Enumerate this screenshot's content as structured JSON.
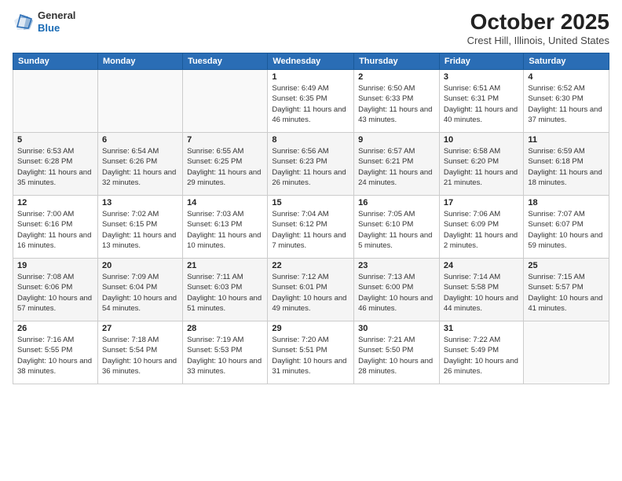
{
  "header": {
    "logo": {
      "line1": "General",
      "line2": "Blue"
    },
    "title": "October 2025",
    "location": "Crest Hill, Illinois, United States"
  },
  "weekdays": [
    "Sunday",
    "Monday",
    "Tuesday",
    "Wednesday",
    "Thursday",
    "Friday",
    "Saturday"
  ],
  "weeks": [
    [
      {
        "day": "",
        "sunrise": "",
        "sunset": "",
        "daylight": ""
      },
      {
        "day": "",
        "sunrise": "",
        "sunset": "",
        "daylight": ""
      },
      {
        "day": "",
        "sunrise": "",
        "sunset": "",
        "daylight": ""
      },
      {
        "day": "1",
        "sunrise": "Sunrise: 6:49 AM",
        "sunset": "Sunset: 6:35 PM",
        "daylight": "Daylight: 11 hours and 46 minutes."
      },
      {
        "day": "2",
        "sunrise": "Sunrise: 6:50 AM",
        "sunset": "Sunset: 6:33 PM",
        "daylight": "Daylight: 11 hours and 43 minutes."
      },
      {
        "day": "3",
        "sunrise": "Sunrise: 6:51 AM",
        "sunset": "Sunset: 6:31 PM",
        "daylight": "Daylight: 11 hours and 40 minutes."
      },
      {
        "day": "4",
        "sunrise": "Sunrise: 6:52 AM",
        "sunset": "Sunset: 6:30 PM",
        "daylight": "Daylight: 11 hours and 37 minutes."
      }
    ],
    [
      {
        "day": "5",
        "sunrise": "Sunrise: 6:53 AM",
        "sunset": "Sunset: 6:28 PM",
        "daylight": "Daylight: 11 hours and 35 minutes."
      },
      {
        "day": "6",
        "sunrise": "Sunrise: 6:54 AM",
        "sunset": "Sunset: 6:26 PM",
        "daylight": "Daylight: 11 hours and 32 minutes."
      },
      {
        "day": "7",
        "sunrise": "Sunrise: 6:55 AM",
        "sunset": "Sunset: 6:25 PM",
        "daylight": "Daylight: 11 hours and 29 minutes."
      },
      {
        "day": "8",
        "sunrise": "Sunrise: 6:56 AM",
        "sunset": "Sunset: 6:23 PM",
        "daylight": "Daylight: 11 hours and 26 minutes."
      },
      {
        "day": "9",
        "sunrise": "Sunrise: 6:57 AM",
        "sunset": "Sunset: 6:21 PM",
        "daylight": "Daylight: 11 hours and 24 minutes."
      },
      {
        "day": "10",
        "sunrise": "Sunrise: 6:58 AM",
        "sunset": "Sunset: 6:20 PM",
        "daylight": "Daylight: 11 hours and 21 minutes."
      },
      {
        "day": "11",
        "sunrise": "Sunrise: 6:59 AM",
        "sunset": "Sunset: 6:18 PM",
        "daylight": "Daylight: 11 hours and 18 minutes."
      }
    ],
    [
      {
        "day": "12",
        "sunrise": "Sunrise: 7:00 AM",
        "sunset": "Sunset: 6:16 PM",
        "daylight": "Daylight: 11 hours and 16 minutes."
      },
      {
        "day": "13",
        "sunrise": "Sunrise: 7:02 AM",
        "sunset": "Sunset: 6:15 PM",
        "daylight": "Daylight: 11 hours and 13 minutes."
      },
      {
        "day": "14",
        "sunrise": "Sunrise: 7:03 AM",
        "sunset": "Sunset: 6:13 PM",
        "daylight": "Daylight: 11 hours and 10 minutes."
      },
      {
        "day": "15",
        "sunrise": "Sunrise: 7:04 AM",
        "sunset": "Sunset: 6:12 PM",
        "daylight": "Daylight: 11 hours and 7 minutes."
      },
      {
        "day": "16",
        "sunrise": "Sunrise: 7:05 AM",
        "sunset": "Sunset: 6:10 PM",
        "daylight": "Daylight: 11 hours and 5 minutes."
      },
      {
        "day": "17",
        "sunrise": "Sunrise: 7:06 AM",
        "sunset": "Sunset: 6:09 PM",
        "daylight": "Daylight: 11 hours and 2 minutes."
      },
      {
        "day": "18",
        "sunrise": "Sunrise: 7:07 AM",
        "sunset": "Sunset: 6:07 PM",
        "daylight": "Daylight: 10 hours and 59 minutes."
      }
    ],
    [
      {
        "day": "19",
        "sunrise": "Sunrise: 7:08 AM",
        "sunset": "Sunset: 6:06 PM",
        "daylight": "Daylight: 10 hours and 57 minutes."
      },
      {
        "day": "20",
        "sunrise": "Sunrise: 7:09 AM",
        "sunset": "Sunset: 6:04 PM",
        "daylight": "Daylight: 10 hours and 54 minutes."
      },
      {
        "day": "21",
        "sunrise": "Sunrise: 7:11 AM",
        "sunset": "Sunset: 6:03 PM",
        "daylight": "Daylight: 10 hours and 51 minutes."
      },
      {
        "day": "22",
        "sunrise": "Sunrise: 7:12 AM",
        "sunset": "Sunset: 6:01 PM",
        "daylight": "Daylight: 10 hours and 49 minutes."
      },
      {
        "day": "23",
        "sunrise": "Sunrise: 7:13 AM",
        "sunset": "Sunset: 6:00 PM",
        "daylight": "Daylight: 10 hours and 46 minutes."
      },
      {
        "day": "24",
        "sunrise": "Sunrise: 7:14 AM",
        "sunset": "Sunset: 5:58 PM",
        "daylight": "Daylight: 10 hours and 44 minutes."
      },
      {
        "day": "25",
        "sunrise": "Sunrise: 7:15 AM",
        "sunset": "Sunset: 5:57 PM",
        "daylight": "Daylight: 10 hours and 41 minutes."
      }
    ],
    [
      {
        "day": "26",
        "sunrise": "Sunrise: 7:16 AM",
        "sunset": "Sunset: 5:55 PM",
        "daylight": "Daylight: 10 hours and 38 minutes."
      },
      {
        "day": "27",
        "sunrise": "Sunrise: 7:18 AM",
        "sunset": "Sunset: 5:54 PM",
        "daylight": "Daylight: 10 hours and 36 minutes."
      },
      {
        "day": "28",
        "sunrise": "Sunrise: 7:19 AM",
        "sunset": "Sunset: 5:53 PM",
        "daylight": "Daylight: 10 hours and 33 minutes."
      },
      {
        "day": "29",
        "sunrise": "Sunrise: 7:20 AM",
        "sunset": "Sunset: 5:51 PM",
        "daylight": "Daylight: 10 hours and 31 minutes."
      },
      {
        "day": "30",
        "sunrise": "Sunrise: 7:21 AM",
        "sunset": "Sunset: 5:50 PM",
        "daylight": "Daylight: 10 hours and 28 minutes."
      },
      {
        "day": "31",
        "sunrise": "Sunrise: 7:22 AM",
        "sunset": "Sunset: 5:49 PM",
        "daylight": "Daylight: 10 hours and 26 minutes."
      },
      {
        "day": "",
        "sunrise": "",
        "sunset": "",
        "daylight": ""
      }
    ]
  ]
}
